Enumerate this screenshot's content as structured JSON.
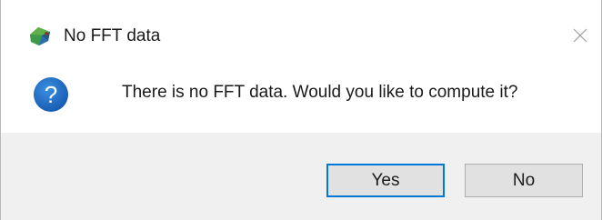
{
  "dialog": {
    "title": "No FFT data",
    "message": "There is no FFT data. Would you like to compute it?",
    "app_icon": "app-logo-icon",
    "message_icon": "question-icon",
    "close_icon": "close-icon",
    "buttons": {
      "yes_label": "Yes",
      "no_label": "No",
      "default": "Yes"
    }
  },
  "colors": {
    "question_icon_blue": "#1e6fc7",
    "default_button_border": "#0078d7",
    "footer_background": "#f0f0f0"
  }
}
